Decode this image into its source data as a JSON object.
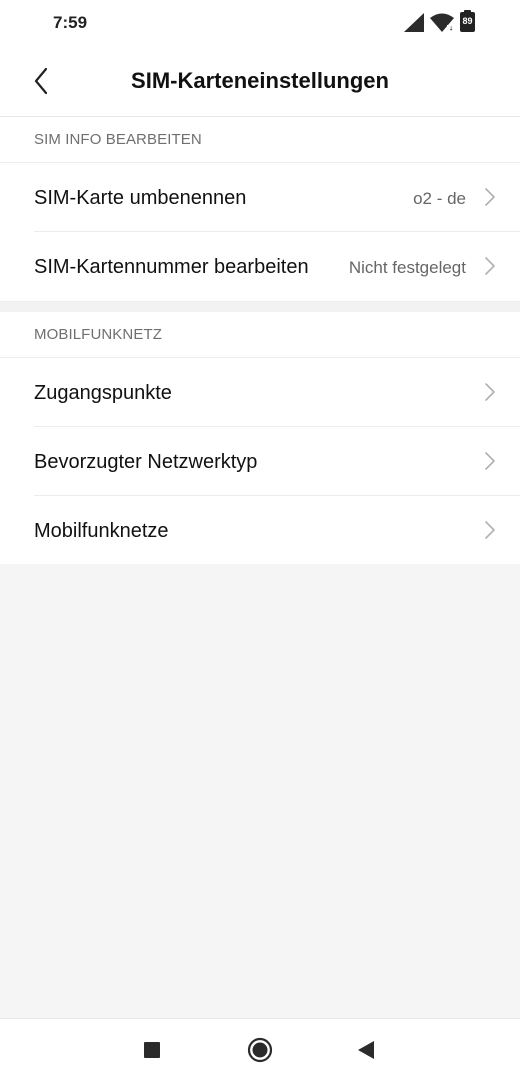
{
  "status_bar": {
    "time": "7:59",
    "battery_level": "89",
    "icons": [
      "signal-icon",
      "wifi-icon",
      "battery-icon"
    ]
  },
  "header": {
    "title": "SIM-Karteneinstellungen",
    "back_icon": "chevron-left-icon"
  },
  "sections": [
    {
      "title": "SIM INFO BEARBEITEN",
      "rows": [
        {
          "label": "SIM-Karte umbenennen",
          "value": "o2 - de"
        },
        {
          "label": "SIM-Kartennummer bearbeiten",
          "value": "Nicht festgelegt"
        }
      ]
    },
    {
      "title": "MOBILFUNKNETZ",
      "rows": [
        {
          "label": "Zugangspunkte",
          "value": ""
        },
        {
          "label": "Bevorzugter Netzwerktyp",
          "value": ""
        },
        {
          "label": "Mobilfunknetze",
          "value": ""
        }
      ]
    }
  ],
  "nav_bar": {
    "icons": [
      "recents-square-icon",
      "home-circle-icon",
      "back-triangle-icon"
    ]
  },
  "colors": {
    "background": "#f5f5f5",
    "surface": "#ffffff",
    "text_primary": "#111111",
    "text_secondary": "#666666",
    "section_header": "#6f6f6f",
    "divider": "#ececec",
    "chevron": "#b0b0b0"
  }
}
